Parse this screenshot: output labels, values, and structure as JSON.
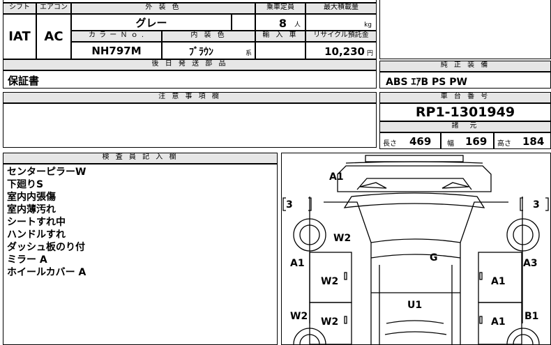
{
  "top_table": {
    "headers": {
      "shift": "シフト",
      "aircon": "エアコン",
      "exterior_color": "外 装 色",
      "capacity": "乗車定員",
      "max_load": "最大積載量",
      "color_no": "カ ラ ー Ｎ ｏ .",
      "interior_color": "内 装 色",
      "import": "輸 入 車",
      "recycle": "リサイクル預託金"
    },
    "values": {
      "shift": "IAT",
      "aircon": "AC",
      "exterior_color": "グレー",
      "capacity": "8",
      "capacity_unit": "人",
      "max_load_unit": "kg",
      "color_no": "NH797M",
      "interior_color": "ﾌﾞﾗｳﾝ",
      "interior_suffix": "系",
      "recycle": "10,230",
      "recycle_unit": "円"
    }
  },
  "later_parts": {
    "header": "後 日 発 送 部 品",
    "value": "保証書"
  },
  "notes_section": {
    "header": "注 意 事 項 欄"
  },
  "equipment": {
    "header": "純 正 装 備",
    "value": "ABS ｴｱB PS PW"
  },
  "chassis": {
    "header": "車 台 番 号",
    "value": "RP1-1301949"
  },
  "dimensions": {
    "header": "諸　元",
    "length_label": "長さ",
    "length": "469",
    "width_label": "幅",
    "width": "169",
    "height_label": "高さ",
    "height": "184"
  },
  "inspector": {
    "header": "検 査 員 記 入 欄",
    "notes": [
      "センターピラーW",
      "下廻りS",
      "室内内張傷",
      "室内薄汚れ",
      "シートすれ中",
      "ハンドルすれ",
      "ダッシュ板のり付",
      "ミラー A",
      "ホイールカバー A"
    ]
  },
  "diagram": {
    "marks": {
      "front_top": "A1",
      "left_bracket": "3",
      "right_bracket": "3",
      "hood_left": "W2",
      "roof": "G",
      "left_front_fender": "A1",
      "right_front_fender": "A3",
      "left_front_door": "W2",
      "right_front_door": "A1",
      "center": "U1",
      "left_rear_quarter": "W2",
      "left_rear_door": "W2",
      "right_rear_door": "A1",
      "right_rear_quarter": "B1"
    }
  }
}
